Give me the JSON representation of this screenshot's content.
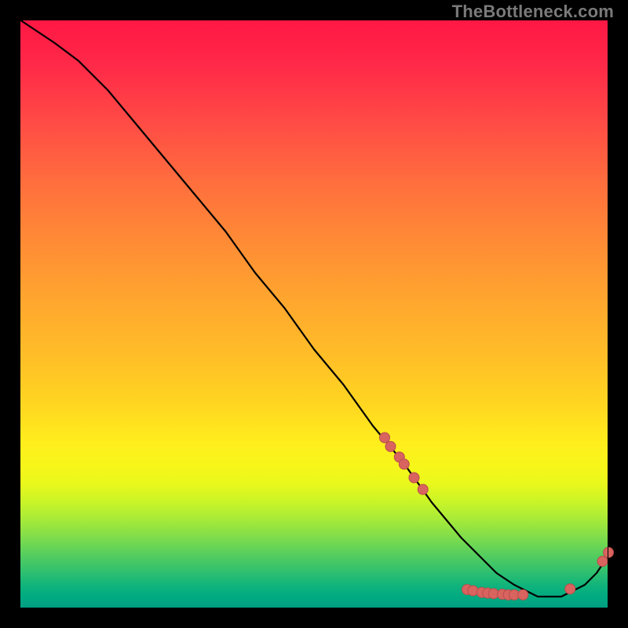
{
  "watermark": "TheBottleneck.com",
  "colors": {
    "background": "#000000",
    "curve": "#000000",
    "marker_fill": "#d9635f",
    "marker_stroke": "#b94f4b"
  },
  "chart_data": {
    "type": "line",
    "title": "",
    "xlabel": "",
    "ylabel": "",
    "xlim": [
      0,
      100
    ],
    "ylim": [
      0,
      100
    ],
    "grid": false,
    "legend": false,
    "series": [
      {
        "name": "bottleneck-curve",
        "x": [
          0,
          3,
          6,
          10,
          15,
          20,
          25,
          30,
          35,
          40,
          45,
          50,
          55,
          60,
          65,
          70,
          75,
          78,
          81,
          84,
          86,
          88,
          90,
          92,
          94,
          96,
          98,
          100
        ],
        "y": [
          100,
          98,
          96,
          93,
          88,
          82,
          76,
          70,
          64,
          57,
          51,
          44,
          38,
          31,
          25,
          18,
          12,
          9,
          6,
          4,
          3,
          2,
          2,
          2,
          3,
          4,
          6,
          9
        ]
      }
    ],
    "markers": [
      {
        "x": 62.0,
        "y": 29.0
      },
      {
        "x": 63.0,
        "y": 27.5
      },
      {
        "x": 64.5,
        "y": 25.7
      },
      {
        "x": 65.3,
        "y": 24.5
      },
      {
        "x": 67.0,
        "y": 22.2
      },
      {
        "x": 68.5,
        "y": 20.2
      },
      {
        "x": 76.0,
        "y": 3.2
      },
      {
        "x": 77.0,
        "y": 3.0
      },
      {
        "x": 78.5,
        "y": 2.7
      },
      {
        "x": 79.5,
        "y": 2.6
      },
      {
        "x": 80.5,
        "y": 2.5
      },
      {
        "x": 82.0,
        "y": 2.4
      },
      {
        "x": 83.0,
        "y": 2.3
      },
      {
        "x": 84.0,
        "y": 2.3
      },
      {
        "x": 85.5,
        "y": 2.3
      },
      {
        "x": 93.5,
        "y": 3.3
      },
      {
        "x": 99.0,
        "y": 8.0
      },
      {
        "x": 100.0,
        "y": 9.5
      }
    ]
  }
}
